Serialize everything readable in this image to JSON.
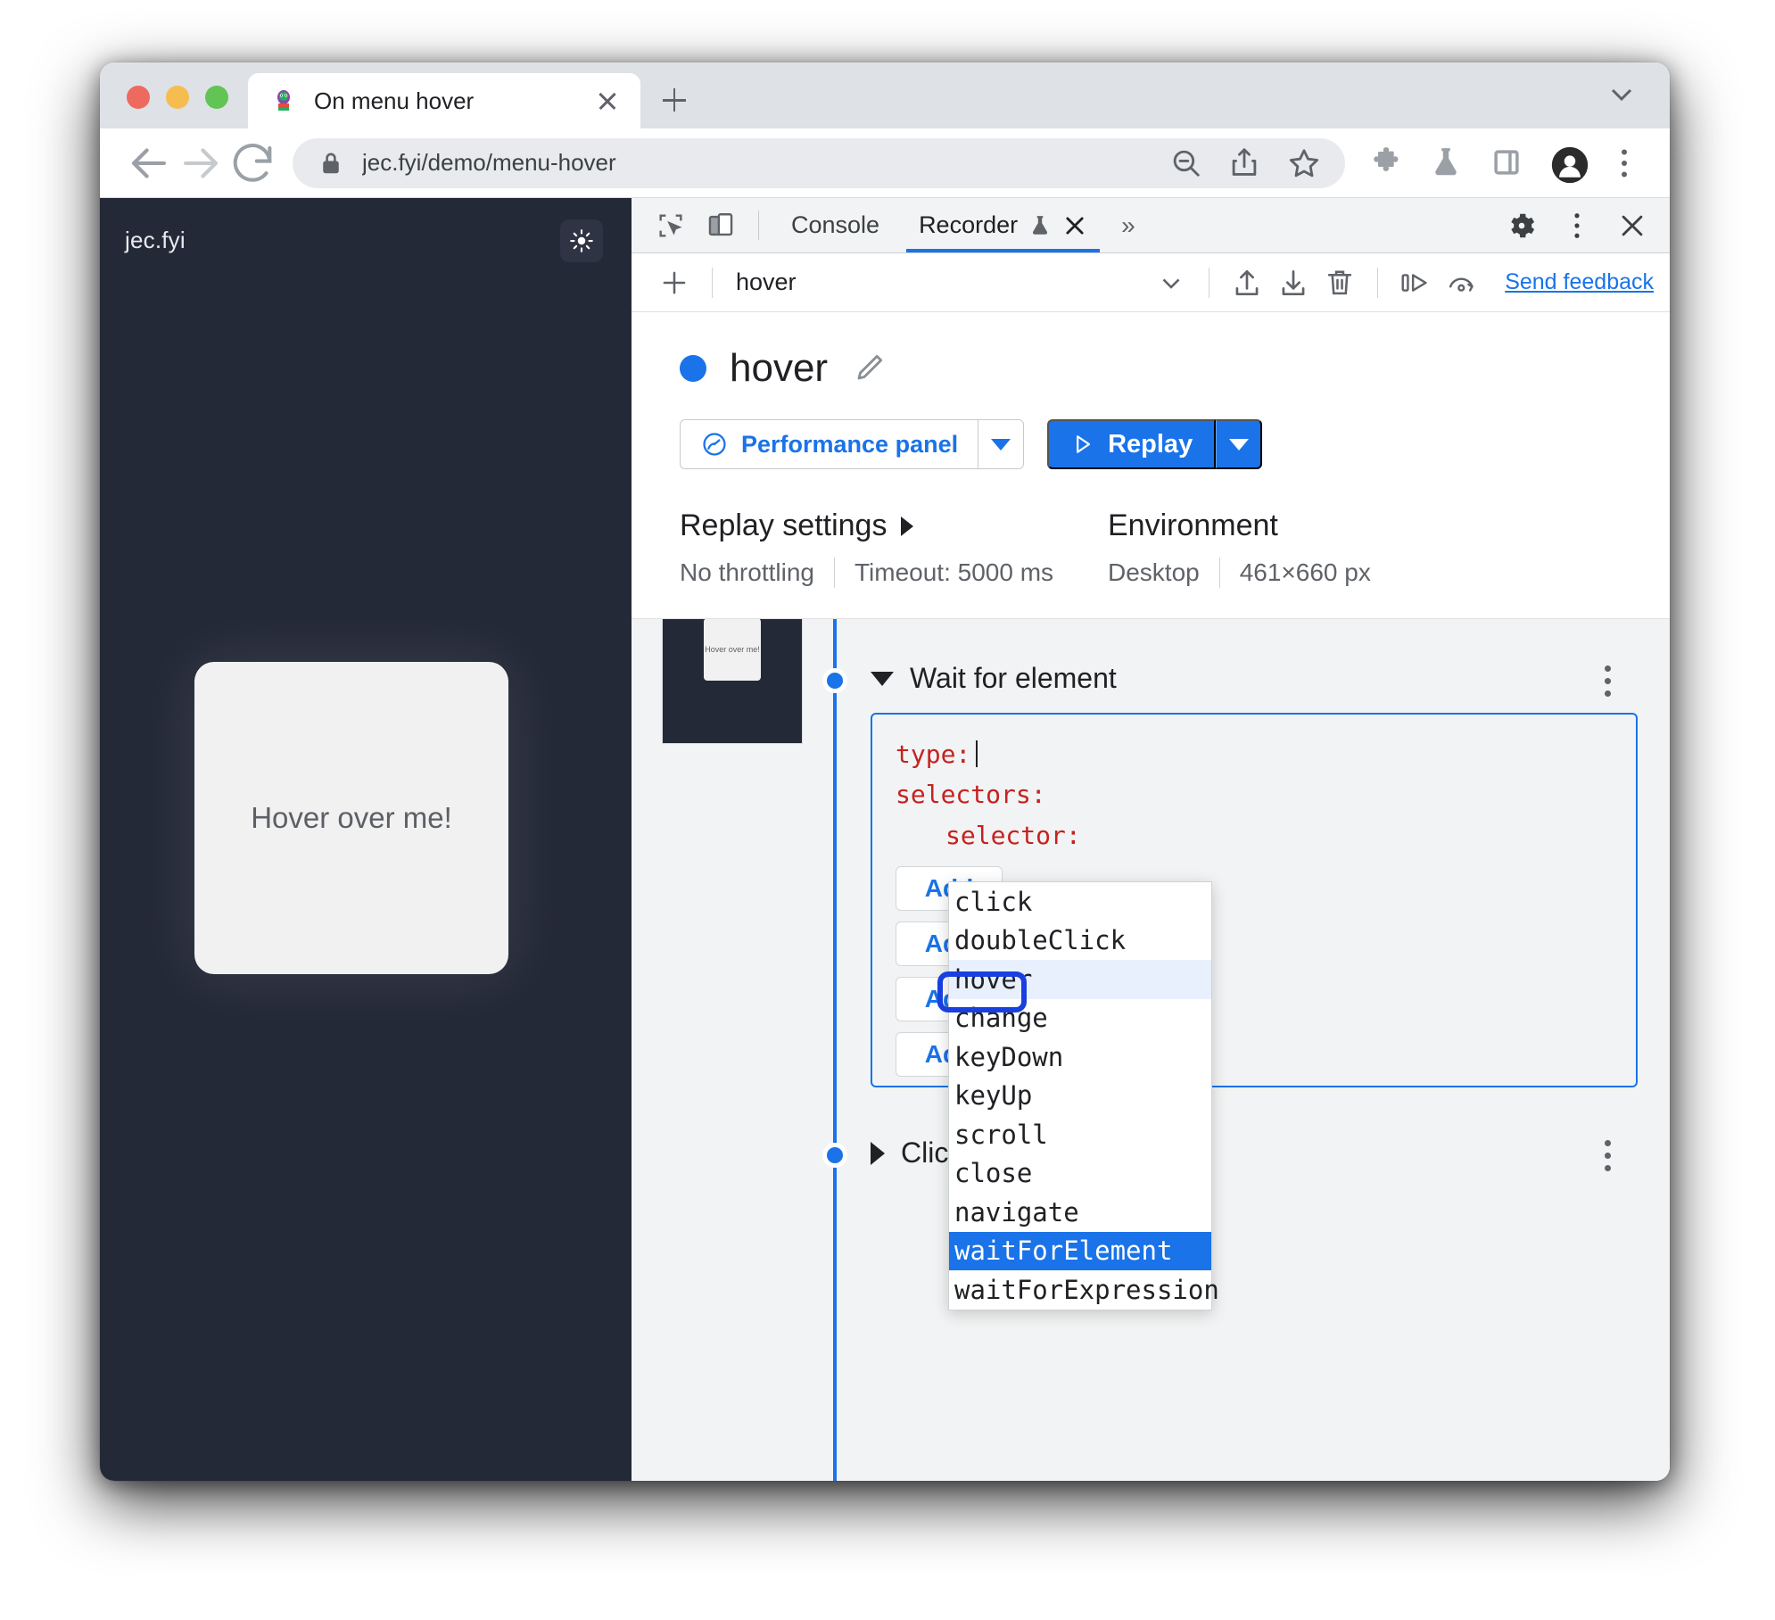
{
  "browser": {
    "tab": {
      "title": "On menu hover",
      "favicon": "site-favicon",
      "close_label": "×"
    },
    "new_tab_label": "+",
    "url": "jec.fyi/demo/menu-hover",
    "lock_icon": "lock-icon",
    "nav": {
      "back": "back-arrow-icon",
      "forward": "forward-arrow-icon",
      "reload": "reload-icon"
    },
    "omni_actions": [
      "zoom-out-icon",
      "share-icon",
      "bookmark-star-icon"
    ],
    "toolbar_icons": [
      "extensions-puzzle-icon",
      "experiments-flask-icon",
      "side-panel-icon",
      "profile-avatar-icon",
      "browser-menu-kebab-icon"
    ],
    "tabstrip_right_icon": "chevron-down-icon"
  },
  "page": {
    "brand": "jec.fyi",
    "theme_toggle": "sun-icon",
    "card_text": "Hover over me!"
  },
  "devtools": {
    "tools": [
      "inspect-element-icon",
      "device-toolbar-icon"
    ],
    "tabs": [
      {
        "label": "Console",
        "active": false
      },
      {
        "label": "Recorder",
        "active": true,
        "badge": "experimental-flask-icon",
        "closable": true
      }
    ],
    "overflow": "»",
    "right_icons": [
      "settings-gear-icon",
      "devtools-menu-kebab-icon",
      "close-devtools-icon"
    ]
  },
  "recorder_toolbar": {
    "add_label": "+",
    "recording_name": "hover",
    "select_caret": "chevron-down-icon",
    "icons": [
      "import-recording-icon",
      "export-recording-icon",
      "delete-recording-icon",
      "step-by-step-replay-icon",
      "replay-with-timing-icon"
    ],
    "feedback_label": "Send feedback"
  },
  "recorder": {
    "status_dot_color": "#1a73e8",
    "title": "hover",
    "edit_icon": "pencil-edit-icon",
    "performance_button": {
      "label": "Performance panel",
      "icon": "performance-gauge-icon",
      "caret": "▾"
    },
    "replay_button": {
      "label": "Replay",
      "icon": "play-triangle-icon",
      "caret": "▾"
    }
  },
  "settings": {
    "replay": {
      "heading": "Replay settings",
      "expand_icon": "▶",
      "throttling": "No throttling",
      "timeout": "Timeout: 5000 ms"
    },
    "environment": {
      "heading": "Environment",
      "device": "Desktop",
      "viewport": "461×660 px"
    }
  },
  "steps": [
    {
      "name": "Wait for element",
      "expanded": true,
      "thumbnail_text": "Hover over me!",
      "editor": {
        "line1_key": "type:",
        "line1_value": "",
        "line2_key": "selectors:",
        "line3_key": "selector:",
        "add_buttons": [
          "Add",
          "Add",
          "Add",
          "Add"
        ]
      },
      "menu_icon": "step-menu-kebab-icon"
    },
    {
      "name": "Click",
      "expanded": false,
      "menu_icon": "step-menu-kebab-icon"
    }
  ],
  "autocomplete": {
    "items": [
      {
        "label": "click",
        "state": "normal"
      },
      {
        "label": "doubleClick",
        "state": "normal"
      },
      {
        "label": "hover",
        "state": "highlight"
      },
      {
        "label": "change",
        "state": "normal"
      },
      {
        "label": "keyDown",
        "state": "normal"
      },
      {
        "label": "keyUp",
        "state": "normal"
      },
      {
        "label": "scroll",
        "state": "normal"
      },
      {
        "label": "close",
        "state": "normal"
      },
      {
        "label": "navigate",
        "state": "normal"
      },
      {
        "label": "waitForElement",
        "state": "selected"
      },
      {
        "label": "waitForExpression",
        "state": "normal"
      }
    ],
    "annotation_color": "#1a3fe0"
  },
  "colors": {
    "accent": "#1a73e8",
    "page_bg": "#242938",
    "panel_bg": "#f1f3f4",
    "keyword": "#c5221f"
  }
}
